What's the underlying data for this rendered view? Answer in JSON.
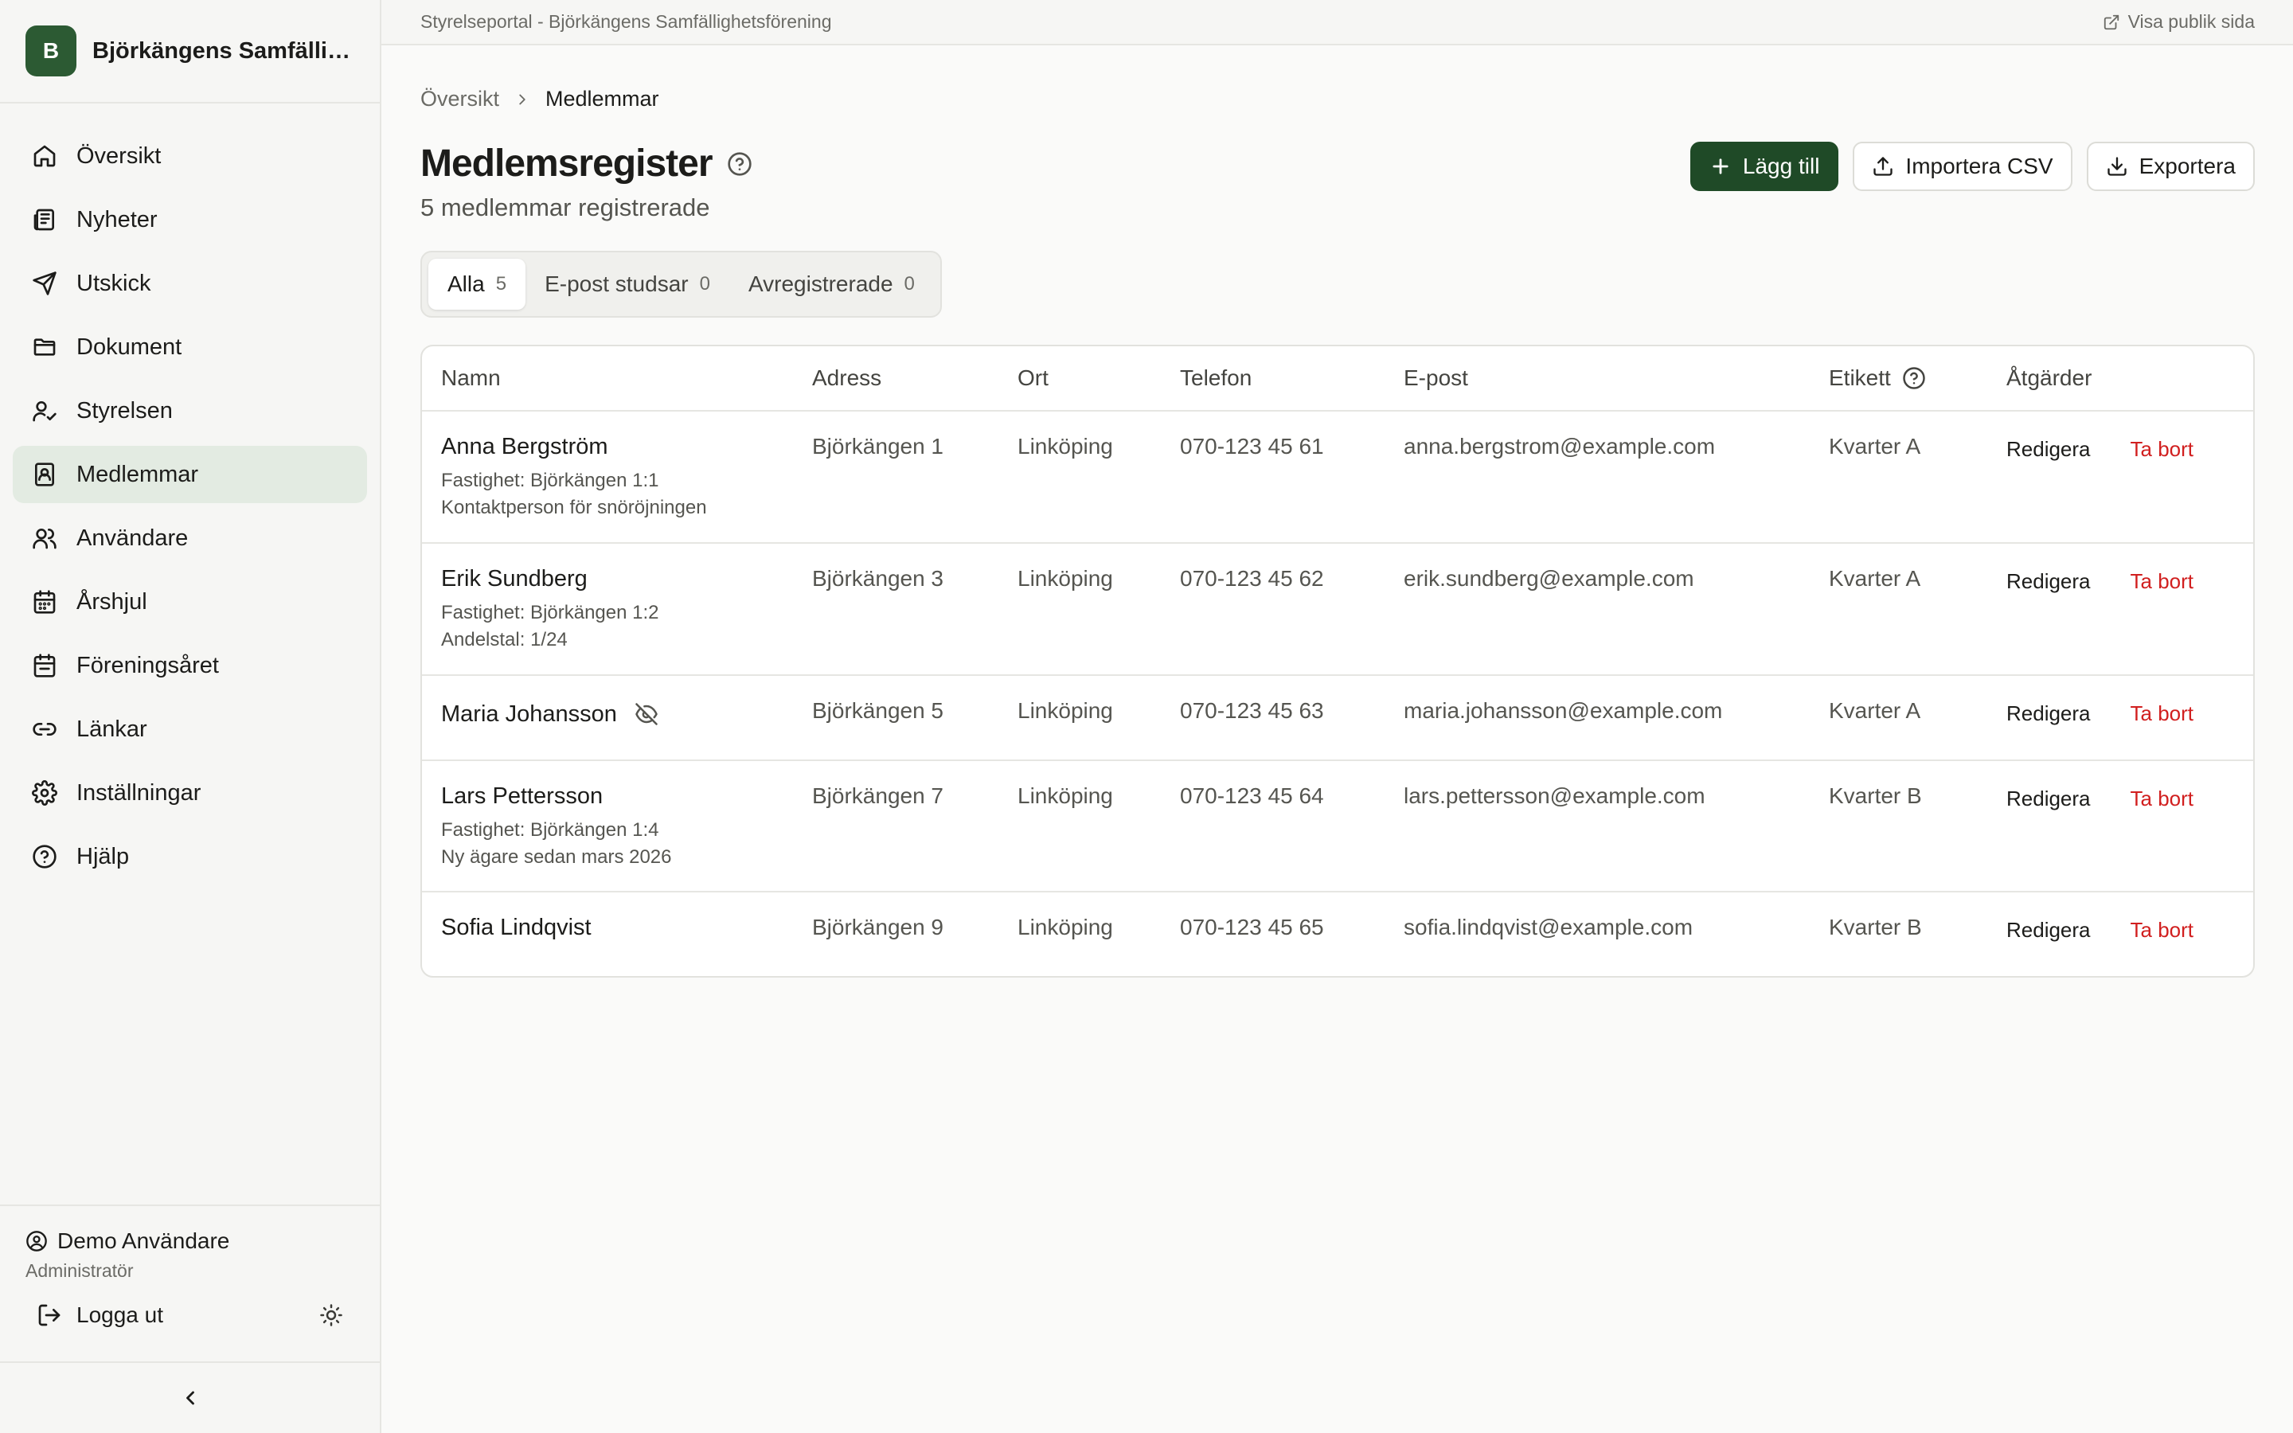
{
  "sidebar": {
    "brand_initial": "B",
    "brand_name": "Björkängens Samfällig...",
    "items": [
      {
        "label": "Översikt",
        "icon": "home-icon"
      },
      {
        "label": "Nyheter",
        "icon": "newspaper-icon"
      },
      {
        "label": "Utskick",
        "icon": "send-icon"
      },
      {
        "label": "Dokument",
        "icon": "folder-icon"
      },
      {
        "label": "Styrelsen",
        "icon": "user-check-icon"
      },
      {
        "label": "Medlemmar",
        "icon": "contact-book-icon",
        "active": true
      },
      {
        "label": "Användare",
        "icon": "users-icon"
      },
      {
        "label": "Årshjul",
        "icon": "calendar-icon"
      },
      {
        "label": "Föreningsåret",
        "icon": "calendar-check-icon"
      },
      {
        "label": "Länkar",
        "icon": "link-icon"
      },
      {
        "label": "Inställningar",
        "icon": "gear-icon"
      },
      {
        "label": "Hjälp",
        "icon": "help-icon"
      }
    ],
    "user_name": "Demo Användare",
    "user_role": "Administratör",
    "logout_label": "Logga ut"
  },
  "topbar": {
    "title": "Styrelseportal - Björkängens Samfällighetsförening",
    "public_link": "Visa publik sida"
  },
  "breadcrumb": {
    "parent": "Översikt",
    "current": "Medlemmar"
  },
  "page": {
    "title": "Medlemsregister",
    "subtitle": "5 medlemmar registrerade"
  },
  "actions": {
    "add": "Lägg till",
    "import": "Importera CSV",
    "export": "Exportera"
  },
  "tabs": [
    {
      "label": "Alla",
      "count": "5",
      "active": true
    },
    {
      "label": "E-post studsar",
      "count": "0"
    },
    {
      "label": "Avregistrerade",
      "count": "0"
    }
  ],
  "table": {
    "columns": [
      "Namn",
      "Adress",
      "Ort",
      "Telefon",
      "E-post",
      "Etikett",
      "Åtgärder"
    ],
    "edit_label": "Redigera",
    "delete_label": "Ta bort",
    "rows": [
      {
        "name": "Anna Bergström",
        "note1": "Fastighet: Björkängen 1:1",
        "note2": "Kontaktperson för snöröjningen",
        "address": "Björkängen 1",
        "city": "Linköping",
        "phone": "070-123 45 61",
        "email": "anna.bergstrom@example.com",
        "tag": "Kvarter A"
      },
      {
        "name": "Erik Sundberg",
        "note1": "Fastighet: Björkängen 1:2",
        "note2": "Andelstal: 1/24",
        "address": "Björkängen 3",
        "city": "Linköping",
        "phone": "070-123 45 62",
        "email": "erik.sundberg@example.com",
        "tag": "Kvarter A"
      },
      {
        "name": "Maria Johansson",
        "hidden_icon": true,
        "address": "Björkängen 5",
        "city": "Linköping",
        "phone": "070-123 45 63",
        "email": "maria.johansson@example.com",
        "tag": "Kvarter A"
      },
      {
        "name": "Lars Pettersson",
        "note1": "Fastighet: Björkängen 1:4",
        "note2": "Ny ägare sedan mars 2026",
        "address": "Björkängen 7",
        "city": "Linköping",
        "phone": "070-123 45 64",
        "email": "lars.pettersson@example.com",
        "tag": "Kvarter B"
      },
      {
        "name": "Sofia Lindqvist",
        "address": "Björkängen 9",
        "city": "Linköping",
        "phone": "070-123 45 65",
        "email": "sofia.lindqvist@example.com",
        "tag": "Kvarter B"
      }
    ]
  },
  "colors": {
    "brand": "#2c5a33",
    "primary_button": "#1f4a27",
    "active_nav": "#e3ebe2",
    "danger": "#d11f1f"
  }
}
